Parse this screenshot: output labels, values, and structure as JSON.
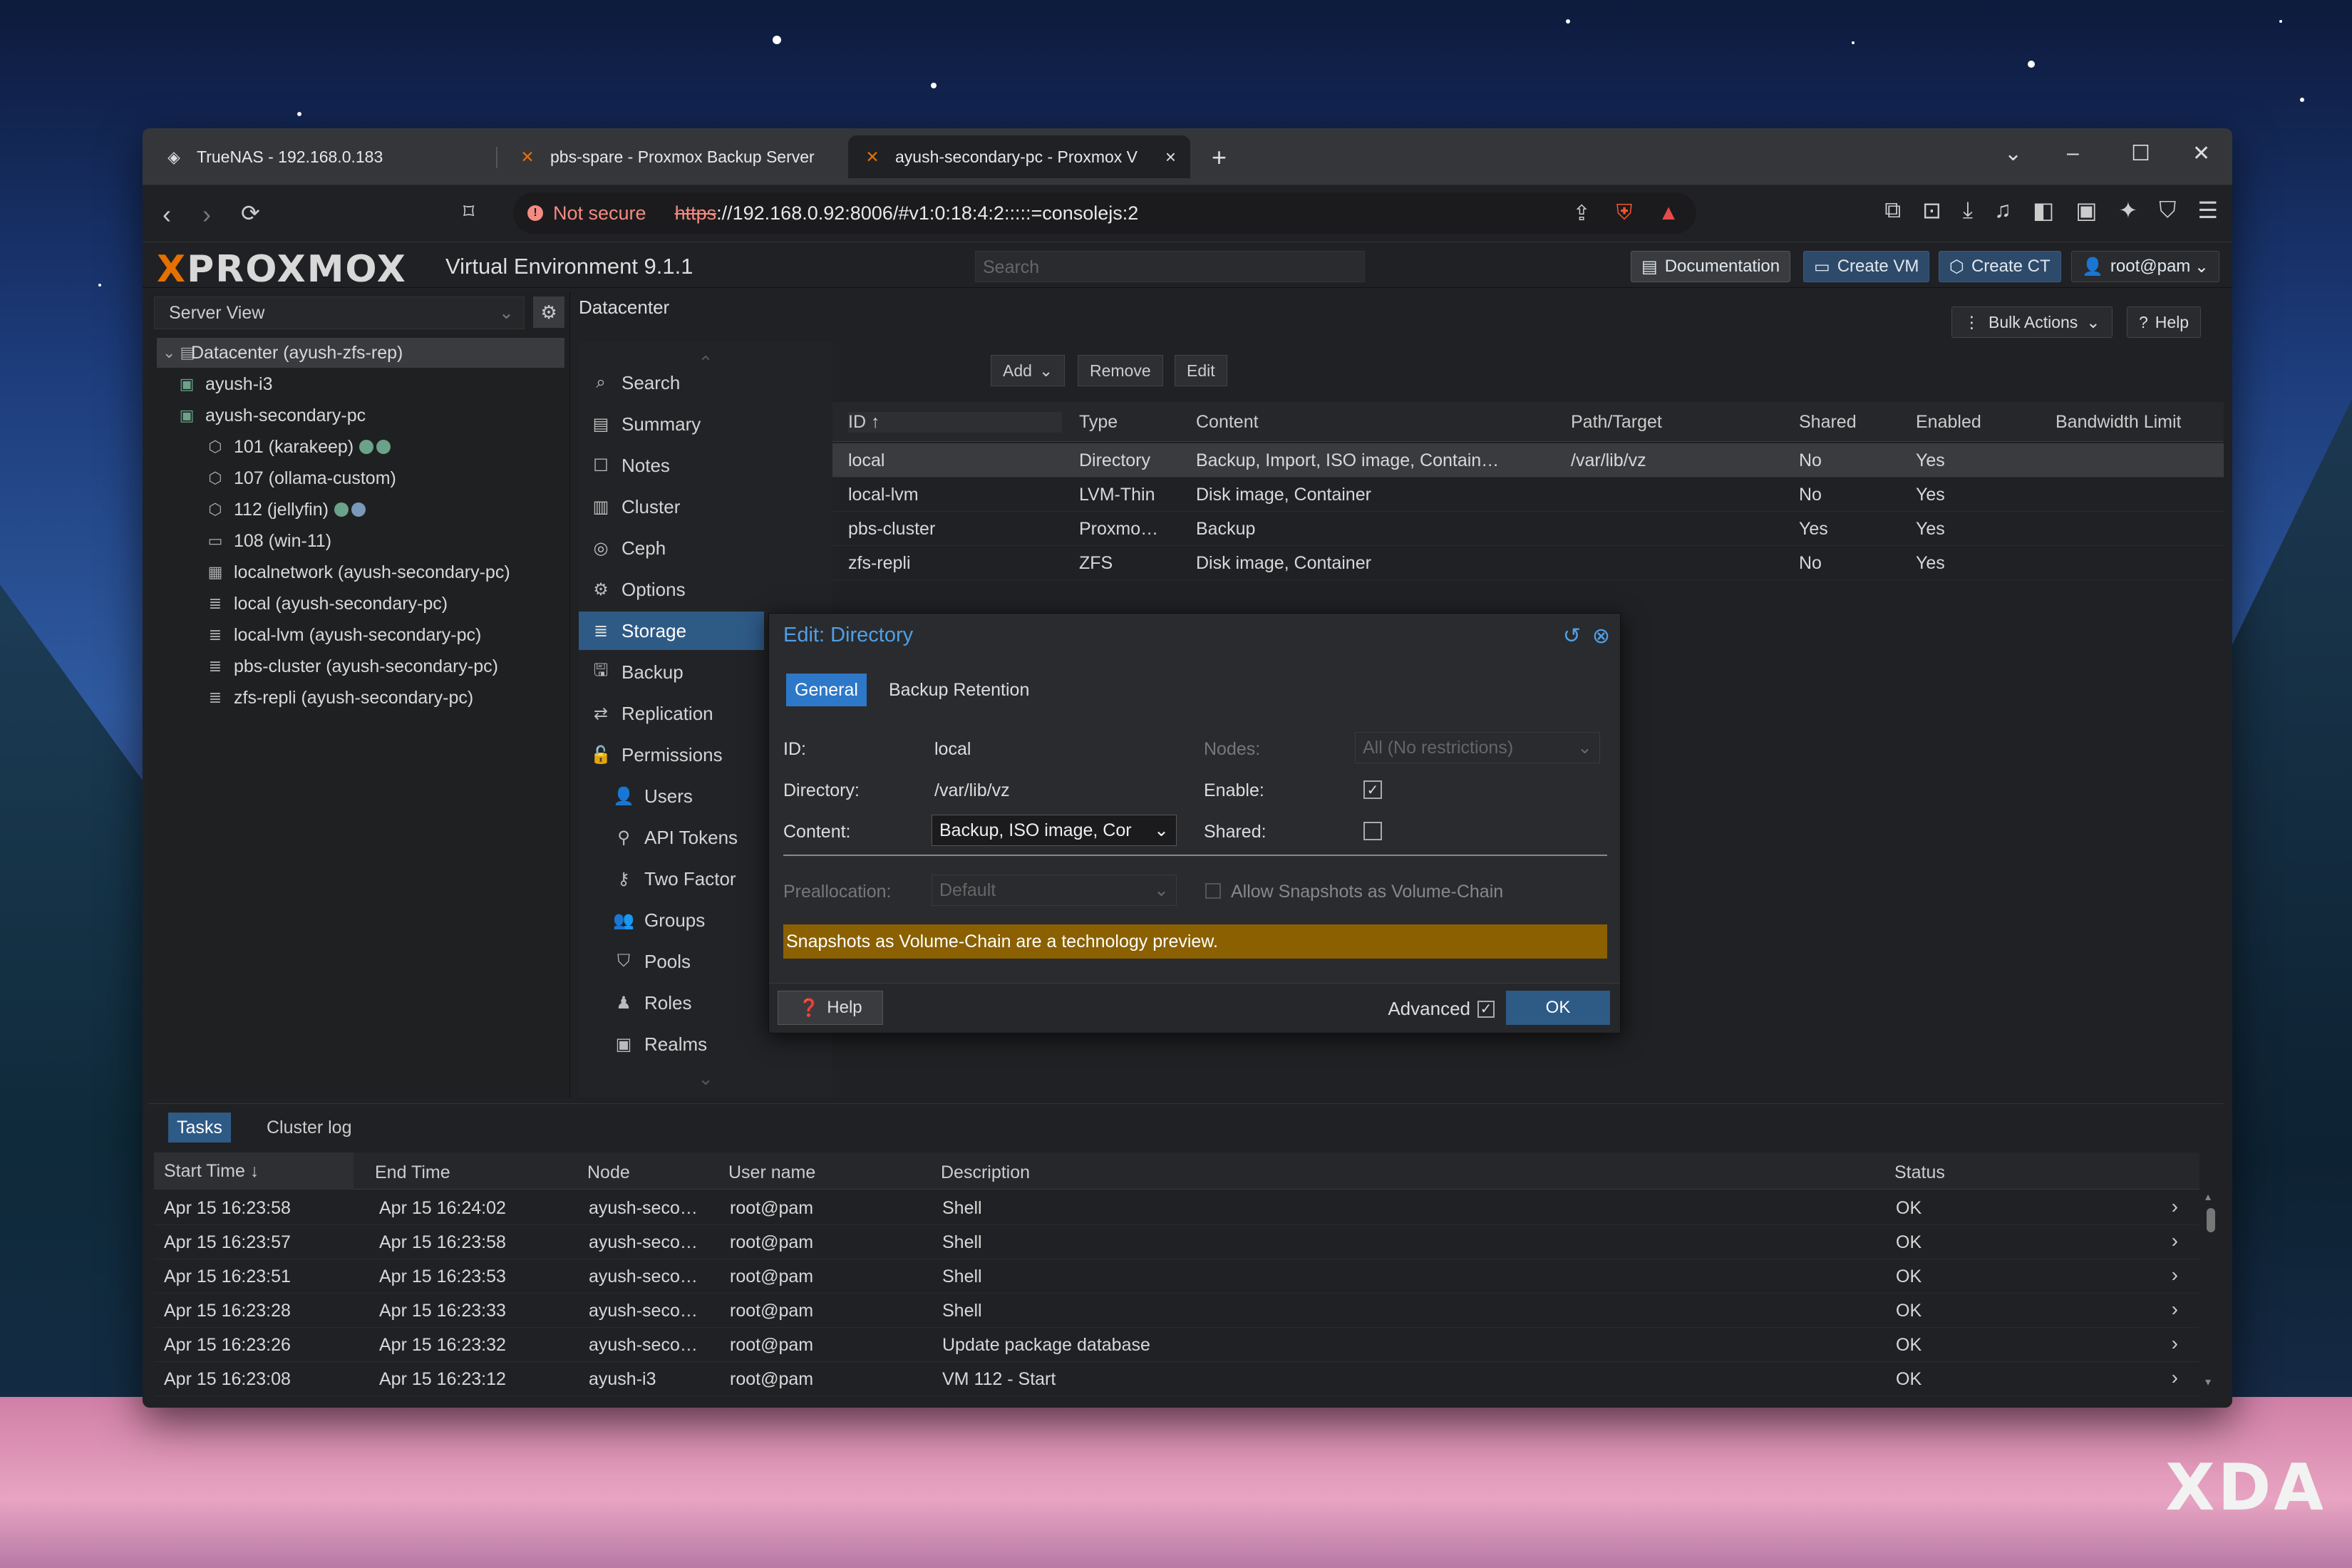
{
  "browser": {
    "tabs": [
      {
        "title": "TrueNAS - 192.168.0.183"
      },
      {
        "title": "pbs-spare - Proxmox Backup Server"
      },
      {
        "title": "ayush-secondary-pc - Proxmox V"
      }
    ],
    "security_label": "Not secure",
    "url_scheme": "https",
    "url_rest": "://192.168.0.92:8006/#v1:0:18:4:2:::::=consolejs:2"
  },
  "header": {
    "logo": "PROXMOX",
    "version": "Virtual Environment 9.1.1",
    "search_placeholder": "Search",
    "buttons": {
      "documentation": "Documentation",
      "create_vm": "Create VM",
      "create_ct": "Create CT",
      "user": "root@pam"
    }
  },
  "tree": {
    "view": "Server View",
    "nodes": [
      {
        "label": "Datacenter (ayush-zfs-rep)",
        "icon": "datacenter-icon"
      },
      {
        "label": "ayush-i3",
        "icon": "node-icon"
      },
      {
        "label": "ayush-secondary-pc",
        "icon": "node-icon"
      },
      {
        "label": "101 (karakeep)",
        "icon": "container-icon"
      },
      {
        "label": "107 (ollama-custom)",
        "icon": "container-icon"
      },
      {
        "label": "112 (jellyfin)",
        "icon": "container-icon"
      },
      {
        "label": "108 (win-11)",
        "icon": "vm-icon"
      },
      {
        "label": "localnetwork (ayush-secondary-pc)",
        "icon": "network-icon"
      },
      {
        "label": "local (ayush-secondary-pc)",
        "icon": "storage-icon"
      },
      {
        "label": "local-lvm (ayush-secondary-pc)",
        "icon": "storage-icon"
      },
      {
        "label": "pbs-cluster (ayush-secondary-pc)",
        "icon": "storage-icon"
      },
      {
        "label": "zfs-repli (ayush-secondary-pc)",
        "icon": "storage-icon"
      }
    ]
  },
  "datacenter": {
    "title": "Datacenter",
    "bulk_actions": "Bulk Actions",
    "help": "Help",
    "menu": [
      {
        "label": "Search",
        "icon": "search-icon"
      },
      {
        "label": "Summary",
        "icon": "summary-icon"
      },
      {
        "label": "Notes",
        "icon": "notes-icon"
      },
      {
        "label": "Cluster",
        "icon": "cluster-icon"
      },
      {
        "label": "Ceph",
        "icon": "ceph-icon"
      },
      {
        "label": "Options",
        "icon": "gear-icon"
      },
      {
        "label": "Storage",
        "icon": "storage-icon"
      },
      {
        "label": "Backup",
        "icon": "backup-icon"
      },
      {
        "label": "Replication",
        "icon": "replication-icon"
      },
      {
        "label": "Permissions",
        "icon": "unlock-icon"
      },
      {
        "label": "Users",
        "icon": "user-icon"
      },
      {
        "label": "API Tokens",
        "icon": "token-icon"
      },
      {
        "label": "Two Factor",
        "icon": "key-icon"
      },
      {
        "label": "Groups",
        "icon": "group-icon"
      },
      {
        "label": "Pools",
        "icon": "tag-icon"
      },
      {
        "label": "Roles",
        "icon": "role-icon"
      },
      {
        "label": "Realms",
        "icon": "realm-icon"
      }
    ]
  },
  "storage": {
    "toolbar": {
      "add": "Add",
      "remove": "Remove",
      "edit": "Edit"
    },
    "columns": [
      "ID",
      "Type",
      "Content",
      "Path/Target",
      "Shared",
      "Enabled",
      "Bandwidth Limit"
    ],
    "rows": [
      [
        "local",
        "Directory",
        "Backup, Import, ISO image, Contain…",
        "/var/lib/vz",
        "No",
        "Yes",
        ""
      ],
      [
        "local-lvm",
        "LVM-Thin",
        "Disk image, Container",
        "",
        "No",
        "Yes",
        ""
      ],
      [
        "pbs-cluster",
        "Proxmo…",
        "Backup",
        "",
        "Yes",
        "Yes",
        ""
      ],
      [
        "zfs-repli",
        "ZFS",
        "Disk image, Container",
        "",
        "No",
        "Yes",
        ""
      ]
    ]
  },
  "dialog": {
    "title": "Edit: Directory",
    "tabs": [
      "General",
      "Backup Retention"
    ],
    "id_label": "ID:",
    "id_value": "local",
    "dir_label": "Directory:",
    "dir_value": "/var/lib/vz",
    "content_label": "Content:",
    "content_value": "Backup, ISO image, Cor",
    "nodes_label": "Nodes:",
    "nodes_value": "All (No restrictions)",
    "enable_label": "Enable:",
    "shared_label": "Shared:",
    "prealloc_label": "Preallocation:",
    "prealloc_value": "Default",
    "snapshots_label": "Allow Snapshots as Volume-Chain",
    "warning": "Snapshots as Volume-Chain are a technology preview.",
    "help": "Help",
    "advanced": "Advanced",
    "ok": "OK",
    "enable_checked": true,
    "shared_checked": false,
    "advanced_checked": true
  },
  "tasks": {
    "tabs": [
      "Tasks",
      "Cluster log"
    ],
    "columns": [
      "Start Time",
      "End Time",
      "Node",
      "User name",
      "Description",
      "Status"
    ],
    "rows": [
      [
        "Apr 15 16:23:58",
        "Apr 15 16:24:02",
        "ayush-seco…",
        "root@pam",
        "Shell",
        "OK"
      ],
      [
        "Apr 15 16:23:57",
        "Apr 15 16:23:58",
        "ayush-seco…",
        "root@pam",
        "Shell",
        "OK"
      ],
      [
        "Apr 15 16:23:51",
        "Apr 15 16:23:53",
        "ayush-seco…",
        "root@pam",
        "Shell",
        "OK"
      ],
      [
        "Apr 15 16:23:28",
        "Apr 15 16:23:33",
        "ayush-seco…",
        "root@pam",
        "Shell",
        "OK"
      ],
      [
        "Apr 15 16:23:26",
        "Apr 15 16:23:32",
        "ayush-seco…",
        "root@pam",
        "Update package database",
        "OK"
      ],
      [
        "Apr 15 16:23:08",
        "Apr 15 16:23:12",
        "ayush-i3",
        "root@pam",
        "VM 112 - Start",
        "OK"
      ]
    ]
  },
  "watermark": "XDA"
}
